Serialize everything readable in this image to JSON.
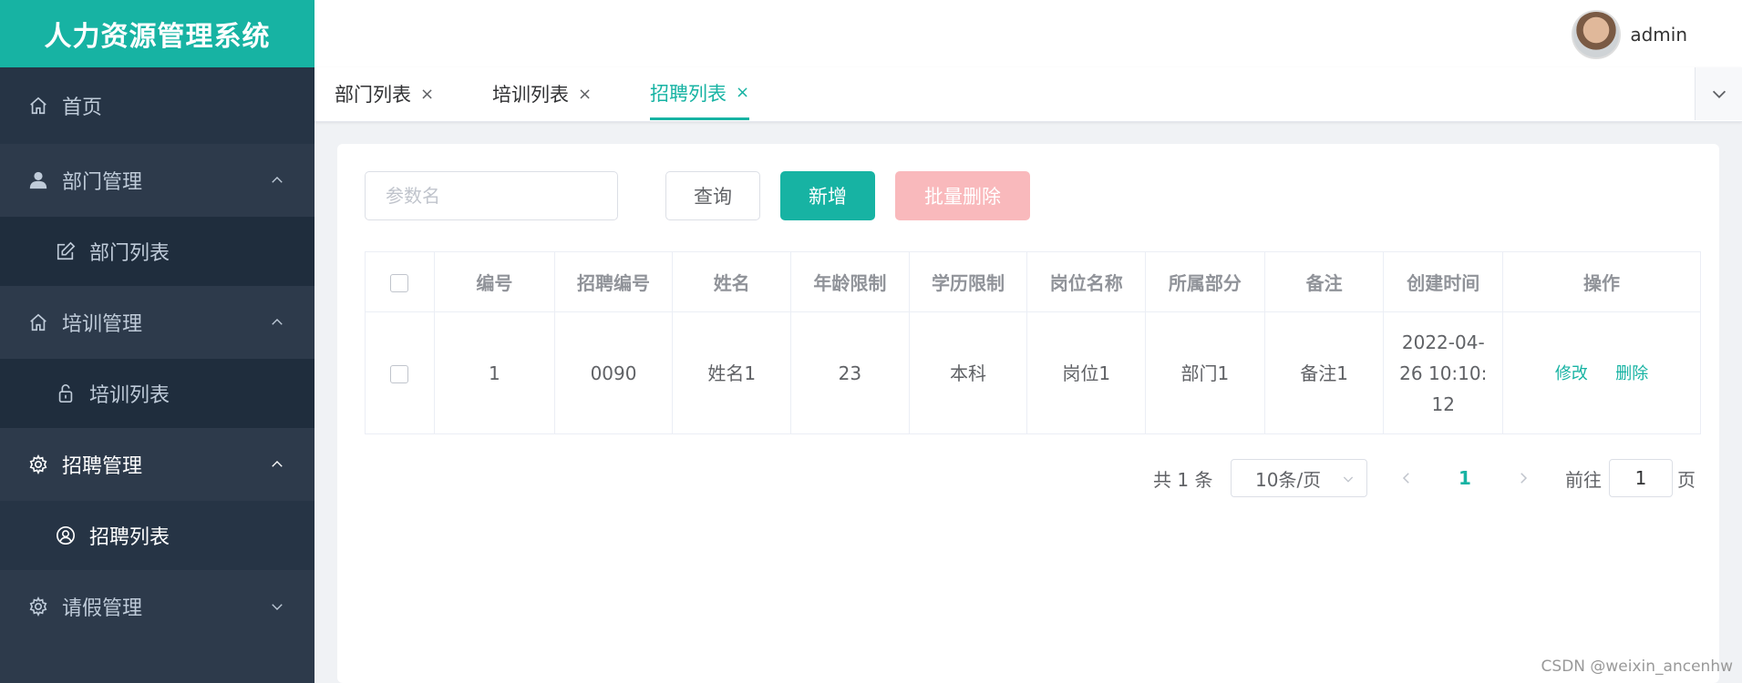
{
  "app_title": "人力资源管理系统",
  "user": {
    "name": "admin"
  },
  "sidebar": {
    "home": "首页",
    "dept": {
      "label": "部门管理",
      "sub": "部门列表"
    },
    "train": {
      "label": "培训管理",
      "sub": "培训列表"
    },
    "recruit": {
      "label": "招聘管理",
      "sub": "招聘列表"
    },
    "leave": {
      "label": "请假管理"
    }
  },
  "tabs": [
    {
      "label": "部门列表",
      "close": "×"
    },
    {
      "label": "培训列表",
      "close": "×"
    },
    {
      "label": "招聘列表",
      "close": "×",
      "active": true
    }
  ],
  "toolbar": {
    "search_placeholder": "参数名",
    "query": "查询",
    "add": "新增",
    "batch_delete": "批量删除"
  },
  "table": {
    "columns": [
      "编号",
      "招聘编号",
      "姓名",
      "年龄限制",
      "学历限制",
      "岗位名称",
      "所属部分",
      "备注",
      "创建时间",
      "操作"
    ],
    "rows": [
      {
        "id": "1",
        "recruit_no": "0090",
        "name": "姓名1",
        "age_limit": "23",
        "edu_limit": "本科",
        "post": "岗位1",
        "dept": "部门1",
        "remark": "备注1",
        "created_l1": "2022-04-",
        "created_l2": "26 10:10:",
        "created_l3": "12",
        "edit": "修改",
        "delete": "删除"
      }
    ]
  },
  "pagination": {
    "total": "共 1 条",
    "page_size": "10条/页",
    "current": "1",
    "goto": "前往",
    "jump_value": "1",
    "unit": "页"
  },
  "watermark": "CSDN @weixin_ancenhw",
  "colors": {
    "accent": "#17b3a3",
    "sidebar": "#2d3a4b",
    "danger_light": "#f9b9bc"
  }
}
